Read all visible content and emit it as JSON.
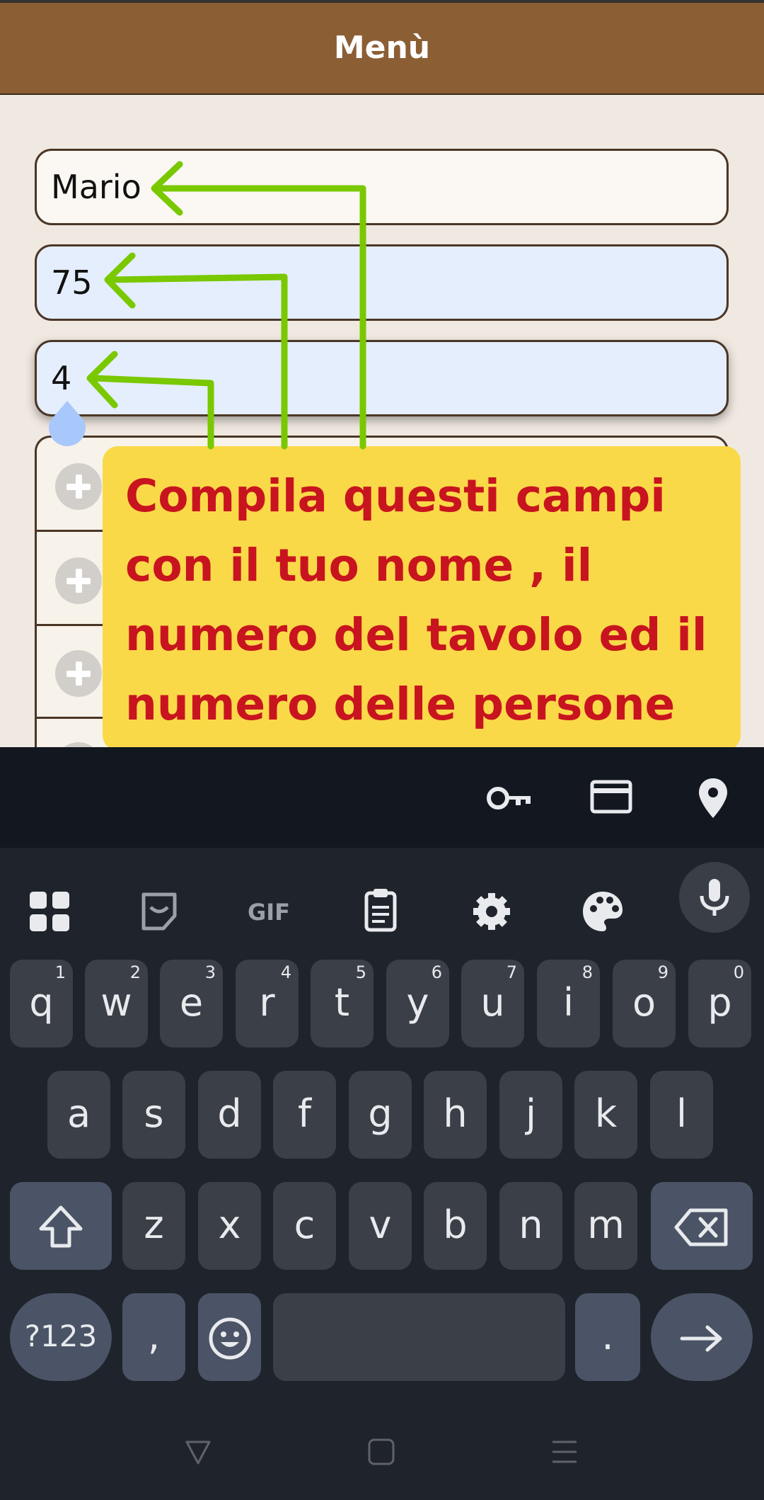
{
  "app": {
    "title": "Menù"
  },
  "form": {
    "name_value": "Mario",
    "table_value": "75",
    "people_value": "4"
  },
  "callout": {
    "text": "Compila questi campi\ncon il tuo nome , il\nnumero del tavolo ed il\nnumero delle persone",
    "text_color": "#c8141f",
    "background": "#fad948"
  },
  "arrows": {
    "color": "#79c800"
  },
  "autofill_bar": {
    "icons": [
      "key-icon",
      "credit-card-icon",
      "location-pin-icon"
    ]
  },
  "keyboard_toolbar": {
    "items": [
      "apps-grid-icon",
      "sticker-icon",
      "GIF",
      "clipboard-icon",
      "settings-gear-icon",
      "palette-icon",
      "microphone-icon"
    ]
  },
  "keyboard": {
    "row1": [
      {
        "k": "q",
        "h": "1"
      },
      {
        "k": "w",
        "h": "2"
      },
      {
        "k": "e",
        "h": "3"
      },
      {
        "k": "r",
        "h": "4"
      },
      {
        "k": "t",
        "h": "5"
      },
      {
        "k": "y",
        "h": "6"
      },
      {
        "k": "u",
        "h": "7"
      },
      {
        "k": "i",
        "h": "8"
      },
      {
        "k": "o",
        "h": "9"
      },
      {
        "k": "p",
        "h": "0"
      }
    ],
    "row2": [
      "a",
      "s",
      "d",
      "f",
      "g",
      "h",
      "j",
      "k",
      "l"
    ],
    "row3": [
      "z",
      "x",
      "c",
      "v",
      "b",
      "n",
      "m"
    ],
    "symbols_label": "?123",
    "comma_label": ",",
    "period_label": "."
  },
  "colors": {
    "header": "#8b5e34",
    "page_background": "#f0e9e1",
    "keyboard_background": "#1f232b"
  }
}
